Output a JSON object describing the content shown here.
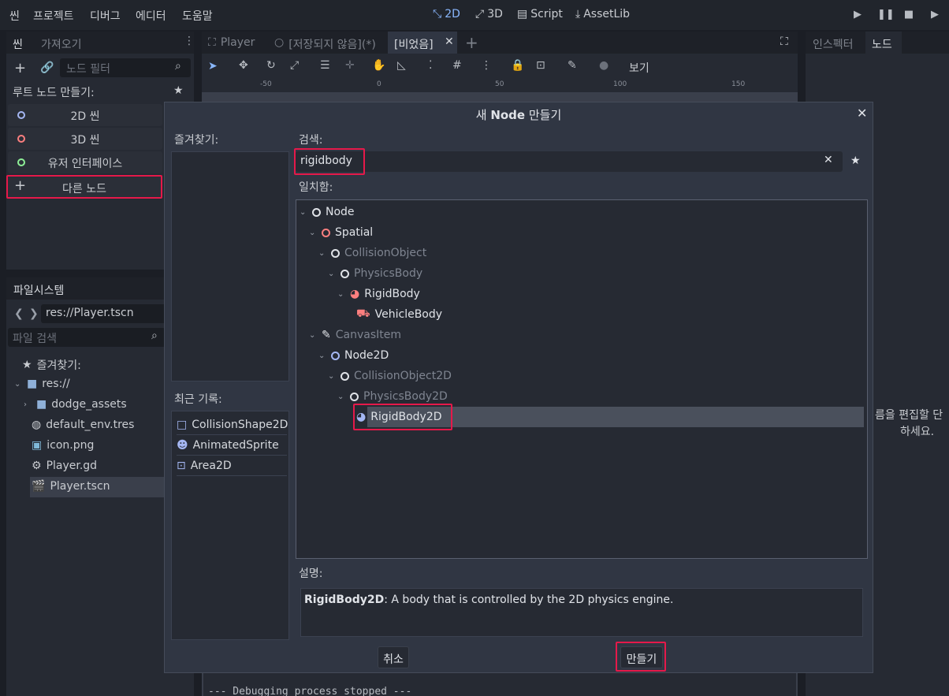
{
  "menu": [
    "씬",
    "프로젝트",
    "디버그",
    "에디터",
    "도움말"
  ],
  "workspaces": [
    "2D",
    "3D",
    "Script",
    "AssetLib"
  ],
  "left_dock": {
    "tabs": [
      "씬",
      "가져오기"
    ],
    "filter_placeholder": "노드 필터",
    "root_label": "루트 노드 만들기:",
    "nodes": [
      "2D 씬",
      "3D 씬",
      "유저 인터페이스",
      "다른 노드"
    ]
  },
  "filesystem": {
    "tab": "파일시스템",
    "path": "res://Player.tscn",
    "search_placeholder": "파일 검색",
    "items": [
      "즐겨찾기:",
      "res://",
      "dodge_assets",
      "default_env.tres",
      "icon.png",
      "Player.gd",
      "Player.tscn"
    ]
  },
  "editor_tabs": [
    "Player",
    "[저장되지 않음](*)",
    "[비었음]"
  ],
  "toolbar": {
    "view_label": "보기"
  },
  "ruler": [
    "-50",
    "0",
    "50",
    "100",
    "150"
  ],
  "right_dock": {
    "tabs": [
      "인스펙터",
      "노드"
    ],
    "hint_line1": "름을 편집할 단",
    "hint_line2": "하세요."
  },
  "output": {
    "text": "--- Debugging process stopped ---"
  },
  "dialog": {
    "title_prefix": "새 ",
    "title_bold": "Node",
    "title_suffix": " 만들기",
    "favorites_label": "즐겨찾기:",
    "recent_label": "최근 기록:",
    "recent": [
      "CollisionShape2D",
      "AnimatedSprite",
      "Area2D"
    ],
    "search_label": "검색:",
    "search_value": "rigidbody",
    "matches_label": "일치함:",
    "tree": [
      "Node",
      "Spatial",
      "CollisionObject",
      "PhysicsBody",
      "RigidBody",
      "VehicleBody",
      "CanvasItem",
      "Node2D",
      "CollisionObject2D",
      "PhysicsBody2D",
      "RigidBody2D"
    ],
    "desc_label": "설명:",
    "desc_bold": "RigidBody2D",
    "desc_text": ": A body that is controlled by the 2D physics engine.",
    "cancel": "취소",
    "create": "만들기"
  },
  "colors": {
    "highlight": "#e5194a",
    "accent": "#8ab8ff",
    "spatial": "#fc7f7f",
    "node2d": "#a5b7f3"
  }
}
